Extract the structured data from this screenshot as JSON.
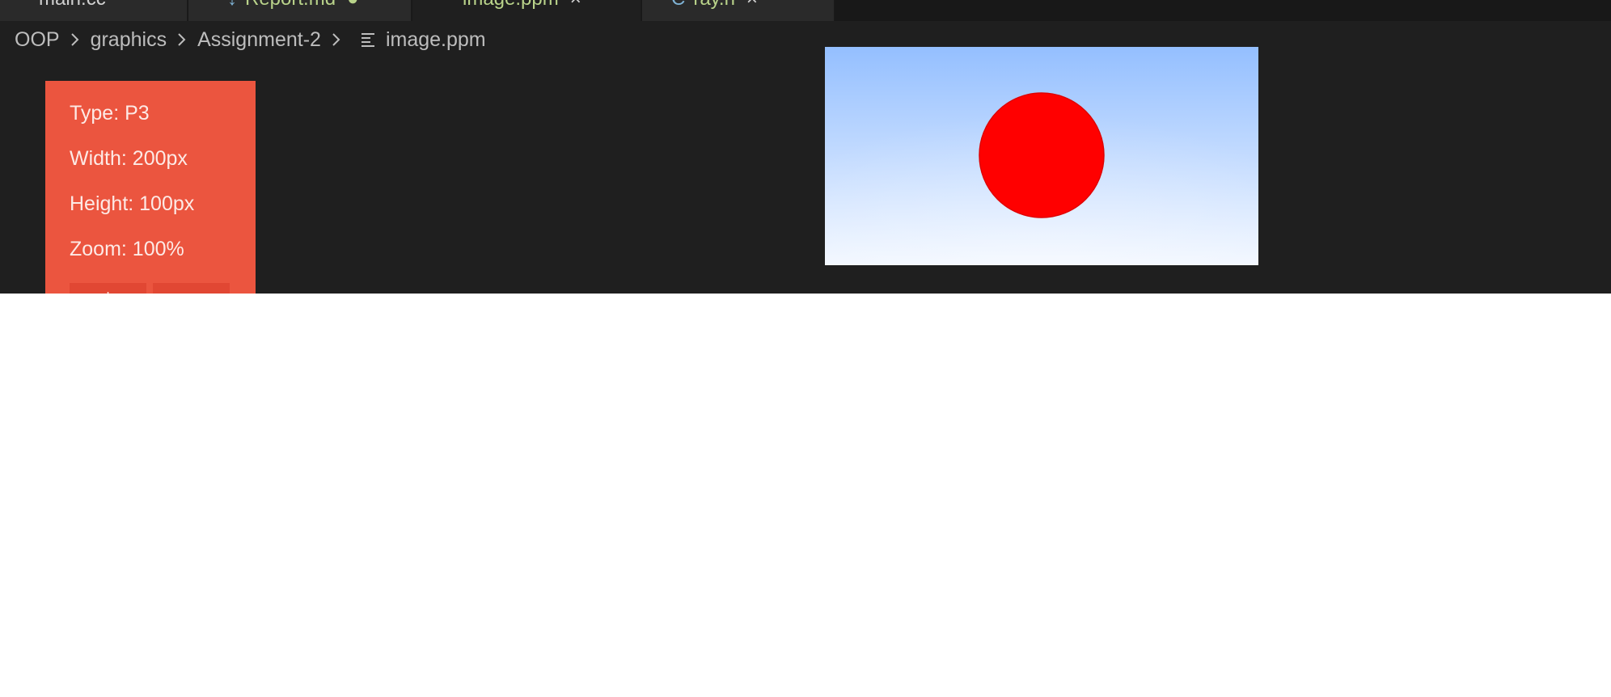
{
  "tabs": [
    {
      "label": "main.cc",
      "marker": "",
      "icon": ""
    },
    {
      "label": "Report.md",
      "marker": "●",
      "icon": "↓"
    },
    {
      "label": "image.ppm",
      "marker": "×",
      "icon": ""
    },
    {
      "label": "ray.h",
      "marker": "×",
      "icon": "C"
    }
  ],
  "breadcrumb": {
    "items": [
      "OOP",
      "graphics",
      "Assignment-2"
    ],
    "file": "image.ppm"
  },
  "info": {
    "type": "Type: P3",
    "width": "Width: 200px",
    "height": "Height: 100px",
    "zoom": "Zoom: 100%",
    "zoom_in_label": "+",
    "zoom_out_label": "−"
  },
  "preview": {
    "sky_top_color": "#94bfff",
    "sky_bottom_color": "#f2f7ff",
    "sphere_color": "#ff0000"
  }
}
